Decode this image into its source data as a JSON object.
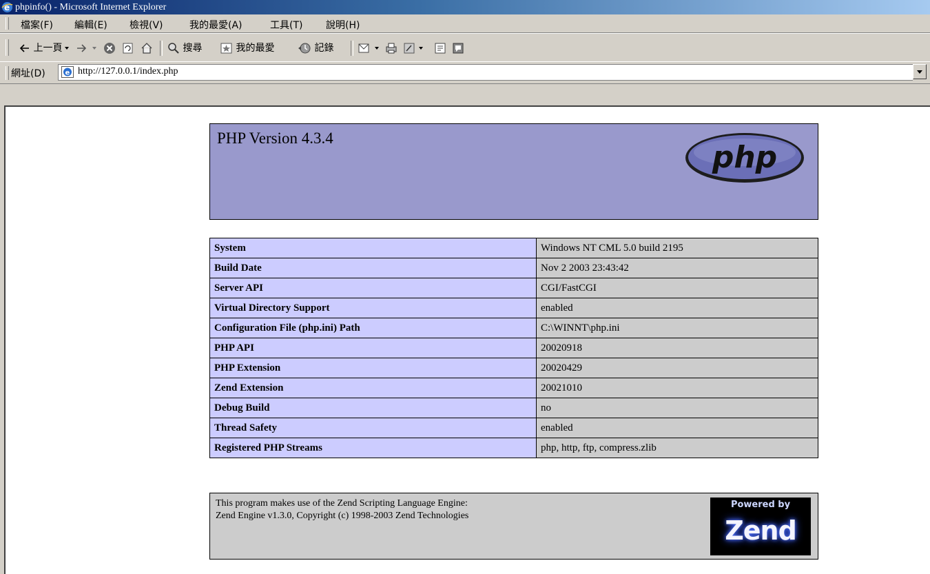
{
  "window": {
    "title": "phpinfo() - Microsoft Internet Explorer"
  },
  "menu": [
    "檔案(F)",
    "編輯(E)",
    "檢視(V)",
    "我的最愛(A)",
    "工具(T)",
    "說明(H)"
  ],
  "toolbar": {
    "back_label": "上一頁",
    "search_label": "搜尋",
    "favorites_label": "我的最愛",
    "history_label": "記錄"
  },
  "address": {
    "label": "網址(D)",
    "url": "http://127.0.0.1/index.php"
  },
  "page": {
    "header_title": "PHP Version 4.3.4",
    "logo_text": "php",
    "rows": [
      {
        "key": "System",
        "value": "Windows NT CML 5.0 build 2195"
      },
      {
        "key": "Build Date",
        "value": "Nov 2 2003 23:43:42"
      },
      {
        "key": "Server API",
        "value": "CGI/FastCGI"
      },
      {
        "key": "Virtual Directory Support",
        "value": "enabled"
      },
      {
        "key": "Configuration File (php.ini) Path",
        "value": "C:\\WINNT\\php.ini"
      },
      {
        "key": "PHP API",
        "value": "20020918"
      },
      {
        "key": "PHP Extension",
        "value": "20020429"
      },
      {
        "key": "Zend Extension",
        "value": "20021010"
      },
      {
        "key": "Debug Build",
        "value": "no"
      },
      {
        "key": "Thread Safety",
        "value": "enabled"
      },
      {
        "key": "Registered PHP Streams",
        "value": "php, http, ftp, compress.zlib"
      }
    ],
    "footer_line1": "This program makes use of the Zend Scripting Language Engine:",
    "footer_line2": "Zend Engine v1.3.0, Copyright (c) 1998-2003 Zend Technologies",
    "zend_small": "Powered by",
    "zend_big": "Zend"
  },
  "colors": {
    "header_bg": "#9999cc",
    "key_bg": "#ccccff",
    "value_bg": "#cccccc",
    "titlebar_start": "#0a246a"
  }
}
